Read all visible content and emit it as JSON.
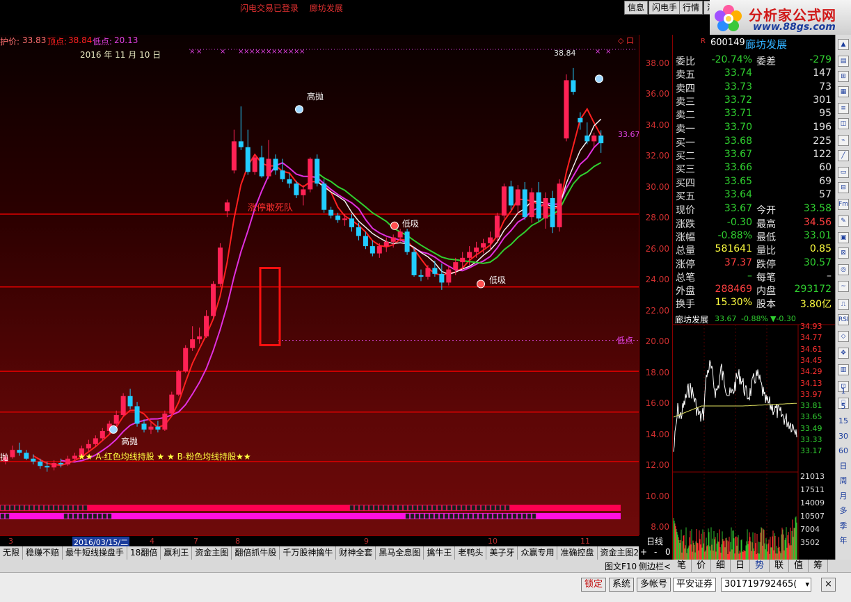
{
  "top": {
    "status1": "闪电交易已登录",
    "status2": "廊坊发展",
    "btn_info": "信息",
    "btn_flash": "闪电手",
    "btn_quote": "行情",
    "btn_cut": "洋"
  },
  "logo": {
    "title": "分析家公式网",
    "url": "www.88gs.com"
  },
  "info": {
    "label_protect": "护价:",
    "val_protect": "33.83",
    "label_top": "顶点:",
    "val_top": "38.84",
    "label_low": "低点:",
    "val_low": "20.13",
    "date": "2016 年 11 月 10 日",
    "max_price_label": "38.84",
    "last_price_label": "33.67",
    "diamond": "◇ 口"
  },
  "annotations": {
    "gaopao1": "高抛",
    "gaopao2": "高抛",
    "gaopao3": "抛",
    "dixi1": "低吸",
    "dixi2": "低吸",
    "zhangting": "涨停敢死队",
    "didian": "低点",
    "legend_line": "★★ A-红色均线持股 ★ ★ B-粉色均线持股★★"
  },
  "price_axis": [
    "38.00",
    "36.00",
    "34.00",
    "32.00",
    "30.00",
    "28.00",
    "26.00",
    "24.00",
    "22.00",
    "20.00",
    "18.00",
    "16.00",
    "14.00",
    "12.00",
    "10.00",
    "8.00",
    "0"
  ],
  "chart_data": {
    "type": "candlestick",
    "symbol": "600149",
    "name": "廊坊发展",
    "y_range": [
      7.5,
      39.5
    ],
    "period": "日线",
    "candles": [
      [
        11.8,
        12.3,
        11.6,
        12.1
      ],
      [
        12.1,
        12.9,
        12.0,
        12.6
      ],
      [
        12.6,
        13.1,
        12.2,
        12.4
      ],
      [
        12.4,
        12.6,
        11.9,
        12.0
      ],
      [
        12.0,
        12.3,
        11.6,
        11.8
      ],
      [
        11.8,
        12.0,
        11.3,
        11.5
      ],
      [
        11.5,
        11.8,
        11.1,
        11.4
      ],
      [
        11.4,
        11.9,
        11.2,
        11.7
      ],
      [
        11.7,
        12.0,
        11.4,
        11.6
      ],
      [
        11.6,
        12.2,
        11.5,
        12.0
      ],
      [
        12.0,
        12.4,
        11.8,
        12.2
      ],
      [
        12.2,
        12.9,
        12.1,
        12.7
      ],
      [
        12.7,
        13.3,
        12.5,
        13.0
      ],
      [
        13.0,
        13.6,
        12.8,
        13.4
      ],
      [
        13.4,
        14.1,
        13.2,
        13.9
      ],
      [
        13.9,
        14.6,
        13.7,
        14.4
      ],
      [
        14.4,
        15.3,
        14.2,
        15.0
      ],
      [
        15.0,
        16.5,
        14.9,
        16.3
      ],
      [
        16.3,
        16.8,
        15.4,
        15.6
      ],
      [
        15.6,
        15.9,
        14.2,
        14.4
      ],
      [
        14.4,
        14.7,
        13.8,
        14.0
      ],
      [
        14.0,
        14.5,
        13.7,
        14.2
      ],
      [
        14.2,
        14.6,
        13.8,
        14.0
      ],
      [
        14.0,
        15.3,
        13.9,
        15.1
      ],
      [
        15.1,
        16.6,
        15.0,
        16.4
      ],
      [
        16.4,
        18.1,
        16.3,
        18.0
      ],
      [
        18.0,
        19.8,
        17.9,
        19.6
      ],
      [
        19.6,
        21.1,
        19.4,
        20.2
      ],
      [
        20.2,
        21.0,
        19.9,
        20.4
      ],
      [
        20.4,
        22.2,
        20.3,
        21.8
      ],
      [
        21.8,
        24.2,
        21.6,
        24.0
      ],
      [
        24.0,
        26.8,
        23.8,
        26.5
      ],
      [
        29.0,
        29.8,
        28.6,
        29.6
      ],
      [
        31.8,
        34.6,
        31.6,
        33.8
      ],
      [
        33.8,
        36.2,
        33.2,
        33.4
      ],
      [
        33.4,
        34.6,
        31.5,
        31.7
      ],
      [
        31.7,
        32.9,
        31.5,
        32.7
      ],
      [
        32.7,
        33.5,
        31.3,
        31.4
      ],
      [
        31.4,
        33.9,
        31.2,
        32.6
      ],
      [
        32.6,
        32.9,
        31.5,
        31.8
      ],
      [
        31.8,
        32.6,
        31.0,
        31.2
      ],
      [
        31.2,
        31.6,
        30.6,
        30.9
      ],
      [
        30.9,
        31.1,
        29.9,
        30.1
      ],
      [
        30.1,
        30.8,
        29.4,
        30.5
      ],
      [
        30.5,
        32.7,
        30.3,
        32.6
      ],
      [
        32.6,
        32.9,
        30.7,
        30.9
      ],
      [
        30.9,
        31.2,
        28.9,
        29.1
      ],
      [
        29.1,
        29.3,
        28.5,
        28.7
      ],
      [
        28.7,
        28.9,
        28.2,
        28.4
      ],
      [
        28.4,
        28.8,
        28.0,
        28.5
      ],
      [
        28.5,
        28.8,
        27.6,
        27.9
      ],
      [
        27.9,
        28.2,
        27.0,
        27.3
      ],
      [
        27.3,
        27.6,
        26.4,
        26.6
      ],
      [
        26.6,
        27.0,
        25.9,
        26.1
      ],
      [
        26.1,
        26.8,
        25.8,
        26.6
      ],
      [
        26.6,
        27.2,
        26.2,
        26.9
      ],
      [
        26.9,
        27.4,
        26.5,
        27.2
      ],
      [
        27.2,
        27.8,
        26.9,
        27.6
      ],
      [
        27.6,
        27.8,
        26.0,
        26.2
      ],
      [
        26.2,
        26.5,
        24.5,
        24.6
      ],
      [
        24.6,
        25.0,
        24.2,
        24.5
      ],
      [
        24.5,
        25.3,
        24.3,
        25.1
      ],
      [
        25.1,
        25.6,
        24.5,
        24.7
      ],
      [
        24.7,
        25.4,
        23.6,
        24.1
      ],
      [
        24.1,
        25.2,
        23.9,
        25.0
      ],
      [
        25.0,
        25.8,
        24.6,
        25.5
      ],
      [
        25.5,
        26.2,
        25.0,
        25.8
      ],
      [
        25.8,
        26.6,
        25.3,
        26.2
      ],
      [
        26.2,
        26.9,
        25.8,
        26.5
      ],
      [
        26.5,
        27.1,
        26.1,
        26.8
      ],
      [
        26.8,
        27.6,
        26.3,
        27.2
      ],
      [
        27.2,
        28.9,
        26.9,
        28.7
      ],
      [
        28.7,
        30.9,
        28.5,
        30.7
      ],
      [
        30.7,
        31.1,
        29.1,
        29.4
      ],
      [
        29.4,
        30.8,
        28.8,
        30.5
      ],
      [
        30.5,
        31.0,
        28.4,
        28.6
      ],
      [
        28.6,
        30.6,
        28.2,
        30.3
      ],
      [
        30.3,
        31.0,
        28.3,
        28.5
      ],
      [
        28.5,
        30.3,
        27.8,
        29.9
      ],
      [
        29.9,
        30.4,
        27.5,
        27.9
      ],
      [
        27.9,
        31.2,
        27.6,
        30.9
      ],
      [
        34.0,
        38.4,
        33.8,
        38.0
      ],
      [
        38.0,
        38.84,
        37.0,
        37.2
      ],
      [
        35.4,
        35.8,
        34.6,
        35.1
      ],
      [
        34.2,
        35.1,
        33.6,
        33.8
      ],
      [
        33.8,
        34.4,
        33.4,
        34.2
      ],
      [
        34.2,
        34.56,
        33.01,
        33.67
      ]
    ],
    "ma_white_from": 45,
    "ma_green_from": 45
  },
  "quote": {
    "code": "600149",
    "name": "廊坊发展",
    "rows": [
      {
        "l": "委比",
        "v": "-20.74%",
        "l2": "委差",
        "v2": "-279"
      },
      {
        "l": "卖五",
        "v": "33.74",
        "v2": "147"
      },
      {
        "l": "卖四",
        "v": "33.73",
        "v2": "73"
      },
      {
        "l": "卖三",
        "v": "33.72",
        "v2": "301"
      },
      {
        "l": "卖二",
        "v": "33.71",
        "v2": "95"
      },
      {
        "l": "卖一",
        "v": "33.70",
        "v2": "196"
      },
      {
        "l": "买一",
        "v": "33.68",
        "v2": "225"
      },
      {
        "l": "买二",
        "v": "33.67",
        "v2": "122"
      },
      {
        "l": "买三",
        "v": "33.66",
        "v2": "60"
      },
      {
        "l": "买四",
        "v": "33.65",
        "v2": "69"
      },
      {
        "l": "买五",
        "v": "33.64",
        "v2": "57"
      },
      {
        "l": "现价",
        "v": "33.67",
        "l2": "今开",
        "v2": "33.58"
      },
      {
        "l": "涨跌",
        "v": "-0.30",
        "l2": "最高",
        "v2": "34.56"
      },
      {
        "l": "涨幅",
        "v": "-0.88%",
        "l2": "最低",
        "v2": "33.01"
      },
      {
        "l": "总量",
        "v": "581641",
        "l2": "量比",
        "v2": "0.85"
      },
      {
        "l": "涨停",
        "v": "37.37",
        "l2": "跌停",
        "v2": "30.57"
      },
      {
        "l": "总笔",
        "v": "–",
        "l2": "每笔",
        "v2": "–"
      },
      {
        "l": "外盘",
        "v": "288469",
        "l2": "内盘",
        "v2": "293172"
      },
      {
        "l": "换手",
        "v": "15.30%",
        "l2": "股本",
        "v2": "3.80亿"
      }
    ]
  },
  "mini": {
    "name": "廊坊发展",
    "price": "33.67",
    "pct": "-0.88%",
    "change": "▼-0.30",
    "price_ticks": [
      "34.93",
      "34.77",
      "34.61",
      "34.45",
      "34.29",
      "34.13",
      "33.97",
      "33.81",
      "33.65",
      "33.49",
      "33.33",
      "33.17"
    ],
    "vol_ticks": [
      "21013",
      "17511",
      "14009",
      "10507",
      "7004",
      "3502"
    ]
  },
  "dates": [
    "3",
    "2016/03/15/二",
    "4",
    "7",
    "8",
    "9",
    "10",
    "11"
  ],
  "period_label": "日线",
  "ctrl": {
    "plus": "+",
    "minus": "-",
    "zero": "0"
  },
  "tabs": [
    "无限",
    "稳赚不赔",
    "最牛短线操盘手",
    "18翻倍",
    "赢利王",
    "资金主图",
    "翻倍抓牛股",
    "千万股神擒牛",
    "财神全套",
    "黑马全息图",
    "擒牛王",
    "老鸭头",
    "美子牙",
    "众赢专用",
    "准确控盘",
    "资金主图2"
  ],
  "f10": {
    "graph_f10": "图文F10",
    "sidebar": "侧边栏<"
  },
  "right_tabs": [
    "笔",
    "价",
    "细",
    "日",
    "势",
    "联",
    "值",
    "筹"
  ],
  "tool_nums": [
    "1",
    "5",
    "15",
    "30",
    "60",
    "日",
    "周",
    "月",
    "多",
    "季",
    "年"
  ],
  "status": {
    "lock": "锁定",
    "system": "系统",
    "multi": "多帐号",
    "broker": "平安证券",
    "account": "301719792465(",
    "close": "×"
  },
  "colors": {
    "up": "#ff2255",
    "down": "#22ccff",
    "ma_red": "#ff2020",
    "ma_pink": "#e030e0",
    "ma_white": "#f0f0f0",
    "ma_green": "#30d030",
    "hline": "#e00000",
    "accent_text": "#e03030"
  }
}
